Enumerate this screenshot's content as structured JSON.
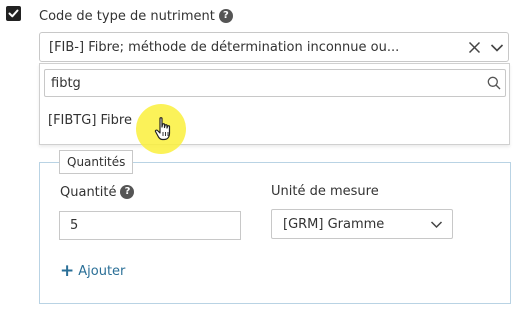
{
  "nutrient_type": {
    "label": "Code de type de nutriment",
    "help": "?",
    "selected_value": "[FIB-] Fibre; méthode de détermination inconnue ou...",
    "search_value": "fibtg",
    "options": [
      "[FIBTG] Fibre"
    ]
  },
  "quantities": {
    "legend": "Quantités",
    "quantity_label": "Quantité",
    "quantity_help": "?",
    "quantity_value": "5",
    "unit_label": "Unité de mesure",
    "unit_value": "[GRM] Gramme",
    "add_label": "Ajouter",
    "add_symbol": "+"
  },
  "colors": {
    "accent": "#2a6f97",
    "cursor_highlight": "#faf03c",
    "fieldset_border": "#b9d3e4"
  },
  "icons": [
    "checkbox-checked-icon",
    "help-icon",
    "clear-icon",
    "chevron-down-icon",
    "search-icon",
    "hand-pointer-icon",
    "plus-icon"
  ]
}
